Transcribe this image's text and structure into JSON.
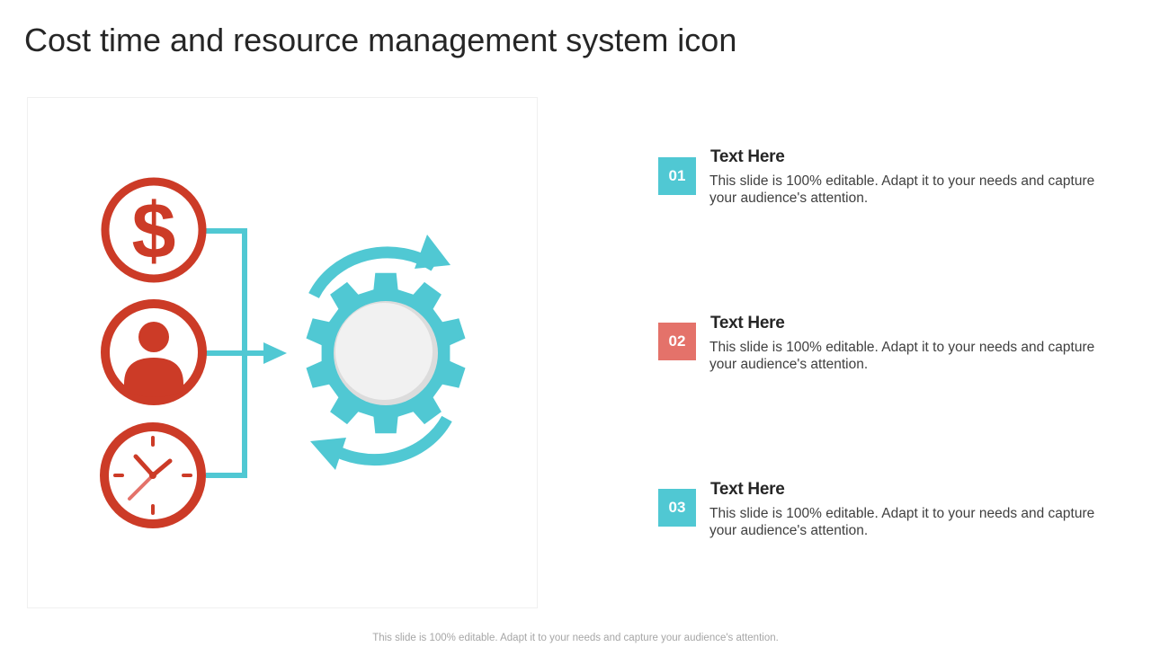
{
  "slide": {
    "title": "Cost time and resource management system icon",
    "footer": "This slide is 100% editable. Adapt it to your needs and capture your audience's attention."
  },
  "colors": {
    "red": "#cc3b27",
    "teal": "#50c8d3",
    "salmon": "#e4726a",
    "gear_center": "#f1f1f1"
  },
  "illustration": {
    "icons": [
      "dollar-icon",
      "person-icon",
      "clock-icon",
      "gear-icon",
      "cycle-arrows-icon"
    ]
  },
  "items": [
    {
      "number": "01",
      "heading": "Text Here",
      "description": "This slide is 100% editable. Adapt it to your needs and capture your audience's attention.",
      "color": "#50c8d3"
    },
    {
      "number": "02",
      "heading": "Text Here",
      "description": "This slide is 100% editable. Adapt it to your needs and capture your audience's attention.",
      "color": "#e4726a"
    },
    {
      "number": "03",
      "heading": "Text Here",
      "description": "This slide is 100% editable. Adapt it to your needs and capture your audience's attention.",
      "color": "#50c8d3"
    }
  ]
}
